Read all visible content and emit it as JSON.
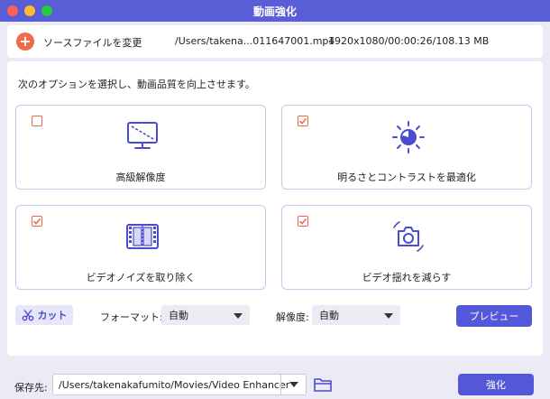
{
  "window": {
    "title": "動画強化"
  },
  "source": {
    "button_label": "ソースファイルを変更",
    "file_path": "/Users/takena...011647001.mp4",
    "file_info": "1920x1080/00:00:26/108.13 MB"
  },
  "instruction": "次のオプションを選択し、動画品質を向上させます。",
  "options": [
    {
      "label": "高級解像度",
      "checked": false,
      "icon": "monitor-upscale-icon"
    },
    {
      "label": "明るさとコントラストを最適化",
      "checked": true,
      "icon": "brightness-icon"
    },
    {
      "label": "ビデオノイズを取り除く",
      "checked": true,
      "icon": "film-denoise-icon"
    },
    {
      "label": "ビデオ揺れを減らす",
      "checked": true,
      "icon": "camera-stabilize-icon"
    }
  ],
  "tools": {
    "cut_label": "カット",
    "format_label": "フォーマット:",
    "format_value": "自動",
    "resolution_label": "解像度:",
    "resolution_value": "自動",
    "preview_label": "プレビュー"
  },
  "save": {
    "label": "保存先:",
    "path": "/Users/takenakafumito/Movies/Video Enhancer",
    "enhance_label": "強化"
  },
  "colors": {
    "accent": "#5457d8",
    "checkbox": "#ec6a4a",
    "card_border": "#c9c6ec",
    "icon": "#4a4bd0"
  }
}
